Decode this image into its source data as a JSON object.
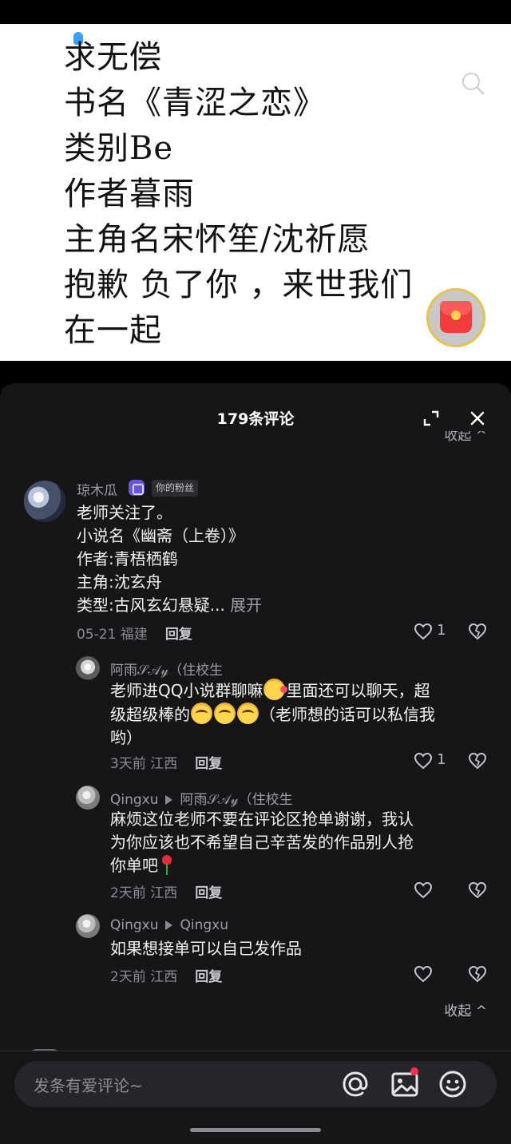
{
  "post": {
    "lines": [
      "求无偿",
      "书名《青涩之恋》",
      "类别Be",
      "作者暮雨",
      "主角名宋怀笙/沈祈愿",
      "抱歉 负了你 ，来世我们",
      "在一起"
    ]
  },
  "sheet": {
    "title": "179条评论",
    "collapse_top": "收起 ^",
    "collapse_bottom": "收起 ^"
  },
  "comments": [
    {
      "username": "琼木瓜",
      "badge": "你的粉丝",
      "text_lines": [
        "老师关注了。",
        "小说名《幽斋（上卷）》",
        "作者:青梧栖鹤",
        "主角:沈玄舟"
      ],
      "last_line": "类型:古风玄幻悬疑...",
      "expand": "展开",
      "date": "05-21 福建",
      "reply": "回复",
      "likes": "1"
    }
  ],
  "replies": [
    {
      "username": "阿雨𝒮𝒜𝓎（住校生",
      "text_a": "老师进QQ小说群聊嘛",
      "text_b": "里面还可以聊天，超",
      "text_c": "级超级棒的",
      "text_d": "（老师想的话可以私信我",
      "text_e": "哟）",
      "date": "3天前 江西",
      "reply": "回复",
      "likes": "1"
    },
    {
      "username": "Qingxu",
      "reply_to": "阿雨𝒮𝒜𝓎（住校生",
      "text_a": "麻烦这位老师不要在评论区抢单谢谢，我认",
      "text_b": "为你应该也不希望自己辛苦发的作品别人抢",
      "text_c": "你单吧",
      "date": "2天前 江西",
      "reply": "回复"
    },
    {
      "username": "Qingxu",
      "reply_to": "Qingxu",
      "text_a": "如果想接单可以自己发作品",
      "date": "2天前 江西",
      "reply": "回复"
    }
  ],
  "input": {
    "placeholder": "发条有爱评论~"
  },
  "colors": {
    "sheet_bg": "#161619",
    "accent_red": "#fe2c55",
    "badge_purple": "#6b55d6"
  },
  "icons": [
    "search-icon",
    "red-packet-icon",
    "expand-icon",
    "close-icon",
    "heart-icon",
    "dislike-heart-icon",
    "at-icon",
    "image-icon",
    "emoji-icon"
  ]
}
